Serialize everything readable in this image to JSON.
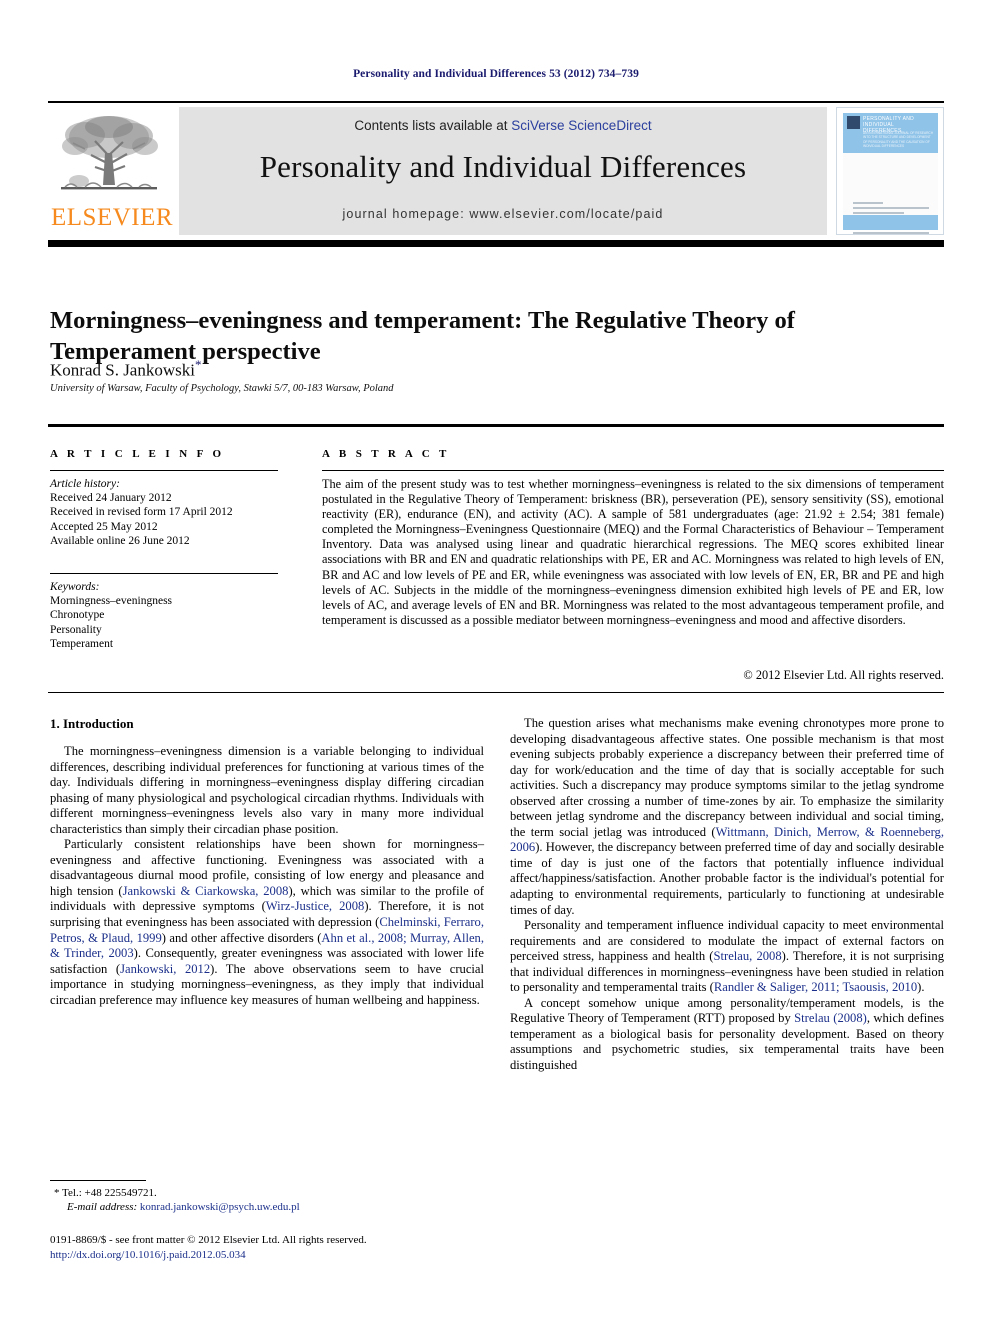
{
  "running_head": "Personality and Individual Differences 53 (2012) 734–739",
  "masthead": {
    "publisher_name": "ELSEVIER",
    "contents_prefix": "Contents lists available at ",
    "sciencedirect": "SciVerse ScienceDirect",
    "journal_title": "Personality and Individual Differences",
    "homepage": "journal homepage: www.elsevier.com/locate/paid",
    "cover": {
      "title": "PERSONALITY AND INDIVIDUAL DIFFERENCES",
      "subtitle": "AN INTERNATIONAL JOURNAL OF RESEARCH INTO THE STRUCTURE AND DEVELOPMENT OF PERSONALITY AND THE CAUSATION OF INDIVIDUAL DIFFERENCES"
    }
  },
  "article": {
    "title": "Morningness–eveningness and temperament: The Regulative Theory of Temperament perspective",
    "author": "Konrad S. Jankowski",
    "author_marker": "*",
    "affiliation": "University of Warsaw, Faculty of Psychology, Stawki 5/7, 00-183 Warsaw, Poland"
  },
  "article_info": {
    "heading": "A R T I C L E   I N F O",
    "history_label": "Article history:",
    "history": [
      "Received 24 January 2012",
      "Received in revised form 17 April 2012",
      "Accepted 25 May 2012",
      "Available online 26 June 2012"
    ],
    "keywords_label": "Keywords:",
    "keywords": [
      "Morningness–eveningness",
      "Chronotype",
      "Personality",
      "Temperament"
    ]
  },
  "abstract": {
    "heading": "A B S T R A C T",
    "text": "The aim of the present study was to test whether morningness–eveningness is related to the six dimensions of temperament postulated in the Regulative Theory of Temperament: briskness (BR), perseveration (PE), sensory sensitivity (SS), emotional reactivity (ER), endurance (EN), and activity (AC). A sample of 581 undergraduates (age: 21.92 ± 2.54; 381 female) completed the Morningness–Eveningness Questionnaire (MEQ) and the Formal Characteristics of Behaviour – Temperament Inventory. Data was analysed using linear and quadratic hierarchical regressions. The MEQ scores exhibited linear associations with BR and EN and quadratic relationships with PE, ER and AC. Morningness was related to high levels of EN, BR and AC and low levels of PE and ER, while eveningness was associated with low levels of EN, ER, BR and PE and high levels of AC. Subjects in the middle of the morningness–eveningness dimension exhibited high levels of PE and ER, low levels of AC, and average levels of EN and BR. Morningness was related to the most advantageous temperament profile, and temperament is discussed as a possible mediator between morningness–eveningness and mood and affective disorders.",
    "copyright": "© 2012 Elsevier Ltd. All rights reserved."
  },
  "body": {
    "section_title": "1. Introduction",
    "left_paragraphs": [
      "The morningness–eveningness dimension is a variable belonging to individual differences, describing individual preferences for functioning at various times of the day. Individuals differing in morningness–eveningness display differing circadian phasing of many physiological and psychological circadian rhythms. Individuals with different morningness–eveningness levels also vary in many more individual characteristics than simply their circadian phase position.",
      "Particularly consistent relationships have been shown for morningness–eveningness and affective functioning. Eveningness was associated with a disadvantageous diurnal mood profile, consisting of low energy and pleasance and high tension (Jankowski & Ciarkowska, 2008), which was similar to the profile of individuals with depressive symptoms (Wirz-Justice, 2008). Therefore, it is not surprising that eveningness has been associated with depression (Chelminski, Ferraro, Petros, & Plaud, 1999) and other affective disorders (Ahn et al., 2008; Murray, Allen, & Trinder, 2003). Consequently, greater eveningness was associated with lower life satisfaction (Jankowski, 2012). The above observations seem to have crucial importance in studying morningness–eveningness, as they imply that individual circadian preference may influence key measures of human wellbeing and happiness."
    ],
    "right_paragraphs": [
      "The question arises what mechanisms make evening chronotypes more prone to developing disadvantageous affective states. One possible mechanism is that most evening subjects probably experience a discrepancy between their preferred time of day for work/education and the time of day that is socially acceptable for such activities. Such a discrepancy may produce symptoms similar to the jetlag syndrome observed after crossing a number of time-zones by air. To emphasize the similarity between jetlag syndrome and the discrepancy between individual and social timing, the term social jetlag was introduced (Wittmann, Dinich, Merrow, & Roenneberg, 2006). However, the discrepancy between preferred time of day and socially desirable time of day is just one of the factors that potentially influence individual affect/happiness/satisfaction. Another probable factor is the individual's potential for adapting to environmental requirements, particularly to functioning at undesirable times of day.",
      "Personality and temperament influence individual capacity to meet environmental requirements and are considered to modulate the impact of external factors on perceived stress, happiness and health (Strelau, 2008). Therefore, it is not surprising that individual differences in morningness–eveningness have been studied in relation to personality and temperamental traits (Randler & Saliger, 2011; Tsaousis, 2010).",
      "A concept somehow unique among personality/temperament models, is the Regulative Theory of Temperament (RTT) proposed by Strelau (2008), which defines temperament as a biological basis for personality development. Based on theory assumptions and psychometric studies, six temperamental traits have been distinguished"
    ],
    "references_inline": [
      "Jankowski & Ciarkowska, 2008",
      "Wirz-Justice, 2008",
      "Chelminski, Ferraro, Petros, & Plaud, 1999",
      "Ahn et al., 2008; Murray, Allen, & Trinder, 2003",
      "Jankowski, 2012",
      "Wittmann, Dinich, Merrow, & Roenneberg, 2006",
      "Strelau, 2008",
      "Randler & Saliger, 2011; Tsaousis, 2010",
      "Strelau (2008)"
    ]
  },
  "footnotes": {
    "tel": "* Tel.: +48 225549721.",
    "email_label": "E-mail address:",
    "email": "konrad.jankowski@psych.uw.edu.pl",
    "issn_line": "0191-8869/$ - see front matter © 2012 Elsevier Ltd. All rights reserved.",
    "doi": "http://dx.doi.org/10.1016/j.paid.2012.05.034"
  }
}
